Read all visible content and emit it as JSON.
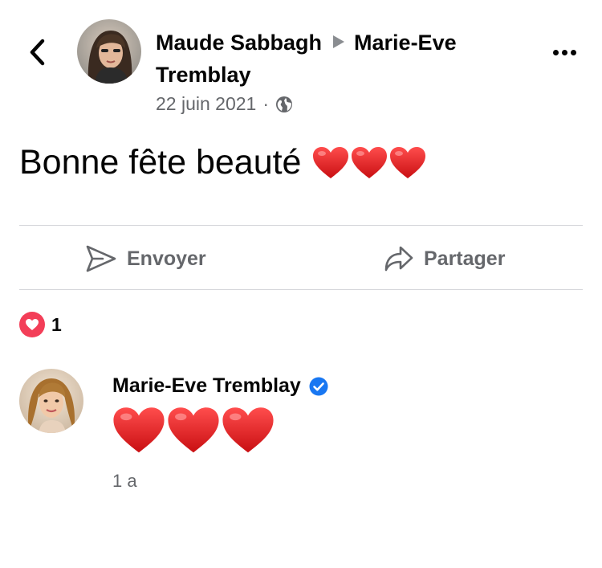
{
  "header": {
    "author": "Maude Sabbagh",
    "recipient_line1": "Marie-Eve",
    "recipient_line2": "Tremblay",
    "date": "22 juin 2021",
    "separator": "·",
    "privacy_icon": "globe-icon",
    "back_icon": "chevron-left-icon",
    "more_icon": "more-dots-icon"
  },
  "post": {
    "text": "Bonne fête beauté",
    "emoji_hearts": 3
  },
  "actions": {
    "send_label": "Envoyer",
    "send_icon": "send-icon",
    "share_label": "Partager",
    "share_icon": "share-arrow-icon"
  },
  "reactions": {
    "type": "love",
    "count": "1",
    "color": "#f33e58"
  },
  "comment": {
    "author": "Marie-Eve Tremblay",
    "verified": true,
    "verified_color": "#1877f2",
    "emoji_hearts": 3,
    "time": "1 a"
  }
}
